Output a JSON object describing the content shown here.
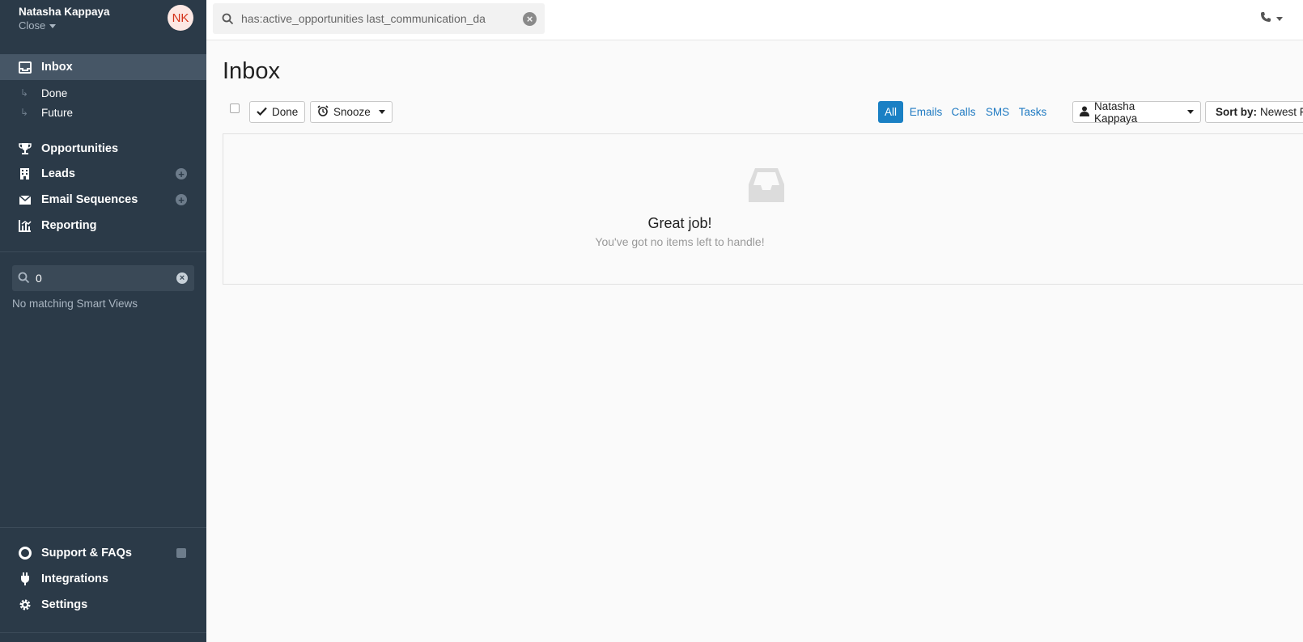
{
  "account": {
    "name": "Natasha Kappaya",
    "org": "Close",
    "avatar_initials": "NK"
  },
  "sidebar": {
    "nav": [
      {
        "label": "Inbox",
        "icon": "inbox-icon",
        "active": true
      },
      {
        "label": "Opportunities",
        "icon": "trophy-icon"
      },
      {
        "label": "Leads",
        "icon": "building-icon",
        "add": true
      },
      {
        "label": "Email Sequences",
        "icon": "envelope-icon",
        "add": true
      },
      {
        "label": "Reporting",
        "icon": "chart-icon"
      }
    ],
    "inbox_sub": [
      {
        "label": "Done"
      },
      {
        "label": "Future"
      }
    ],
    "smart_view_search": {
      "value": "0"
    },
    "no_match_text": "No matching Smart Views",
    "bottom": [
      {
        "label": "Support & FAQs",
        "icon": "lifebuoy-icon"
      },
      {
        "label": "Integrations",
        "icon": "plug-icon"
      },
      {
        "label": "Settings",
        "icon": "gear-icon"
      }
    ]
  },
  "topbar": {
    "search_value": "has:active_opportunities last_communication_da"
  },
  "main": {
    "title": "Inbox",
    "buttons": {
      "done": "Done",
      "snooze": "Snooze"
    },
    "filters": [
      {
        "label": "All",
        "active": true
      },
      {
        "label": "Emails"
      },
      {
        "label": "Calls"
      },
      {
        "label": "SMS"
      },
      {
        "label": "Tasks"
      }
    ],
    "user_filter": "Natasha Kappaya",
    "sort": {
      "label": "Sort by:",
      "value": "Newest F"
    },
    "empty": {
      "title": "Great job!",
      "subtitle": "You've got no items left to handle!"
    }
  },
  "colors": {
    "sidebar_bg": "#2b3a48",
    "accent": "#1a80c4",
    "avatar_text": "#d4321a"
  }
}
